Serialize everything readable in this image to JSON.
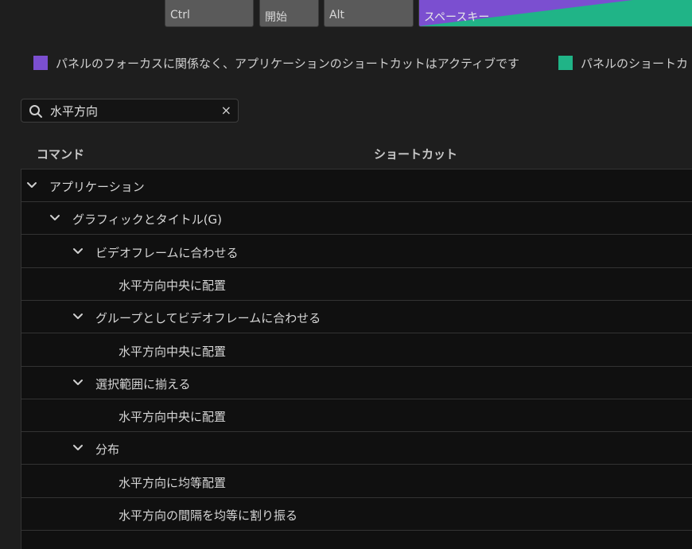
{
  "keyboard": {
    "keys": [
      "Ctrl",
      "開始",
      "Alt",
      "スペースキー"
    ],
    "colors": {
      "key": "#5a5a5a",
      "app_shortcut": "#7b4fd0",
      "panel_shortcut": "#20b487"
    }
  },
  "legend": {
    "app_shortcut_text": "パネルのフォーカスに関係なく、アプリケーションのショートカットはアクティブです",
    "panel_shortcut_text": "パネルのショートカ"
  },
  "search": {
    "value": "水平方向",
    "clear_icon": "×"
  },
  "table": {
    "headers": {
      "command": "コマンド",
      "shortcut": "ショートカット"
    },
    "rows": [
      {
        "label": "アプリケーション",
        "level": 0,
        "expandable": true
      },
      {
        "label": "グラフィックとタイトル(G)",
        "level": 1,
        "expandable": true
      },
      {
        "label": "ビデオフレームに合わせる",
        "level": 2,
        "expandable": true
      },
      {
        "label": "水平方向中央に配置",
        "level": 3,
        "expandable": false
      },
      {
        "label": "グループとしてビデオフレームに合わせる",
        "level": 2,
        "expandable": true
      },
      {
        "label": "水平方向中央に配置",
        "level": 3,
        "expandable": false
      },
      {
        "label": "選択範囲に揃える",
        "level": 2,
        "expandable": true
      },
      {
        "label": "水平方向中央に配置",
        "level": 3,
        "expandable": false
      },
      {
        "label": "分布",
        "level": 2,
        "expandable": true
      },
      {
        "label": "水平方向に均等配置",
        "level": 3,
        "expandable": false
      },
      {
        "label": "水平方向の間隔を均等に割り振る",
        "level": 3,
        "expandable": false
      }
    ]
  }
}
